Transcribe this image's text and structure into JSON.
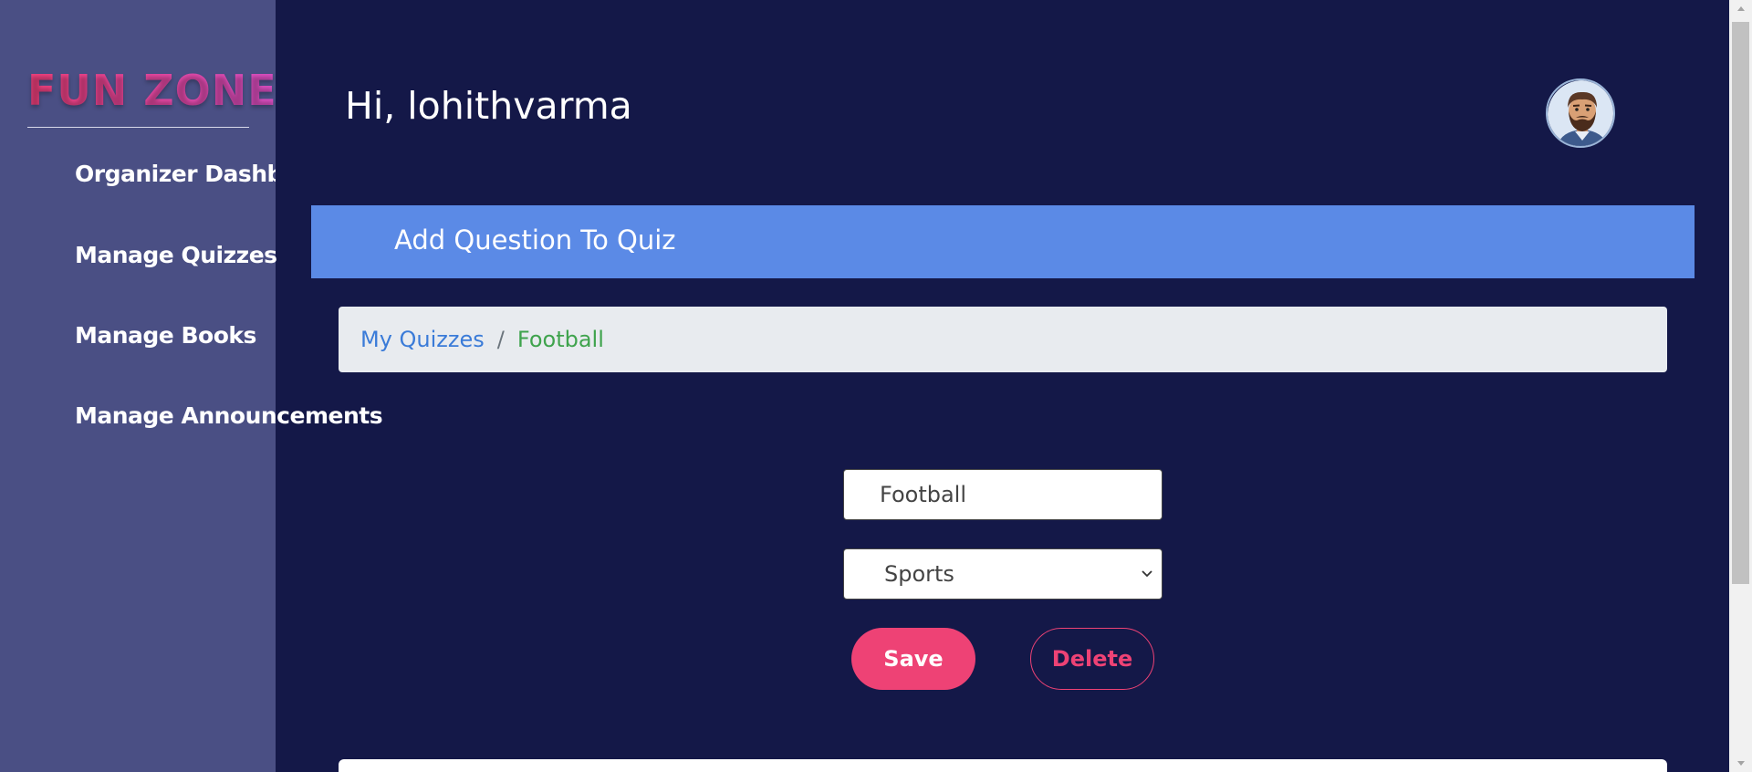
{
  "sidebar": {
    "logo": "FUN ZONE",
    "items": [
      {
        "label": "Organizer Dashboard"
      },
      {
        "label": "Manage Quizzes"
      },
      {
        "label": "Manage Books"
      },
      {
        "label": "Manage Announcements"
      }
    ]
  },
  "header": {
    "greeting": "Hi, lohithvarma",
    "title": "Add Question To Quiz"
  },
  "breadcrumb": {
    "link": "My Quizzes",
    "separator": "/",
    "active": "Football"
  },
  "form": {
    "quiz_name_value": "Football",
    "category_selected": "Sports",
    "save_label": "Save",
    "delete_label": "Delete"
  },
  "colors": {
    "background": "#141848",
    "sidebar": "#4a4f84",
    "header_bar": "#5b8ae6",
    "accent": "#ee4275"
  },
  "icons": {
    "avatar": "bearded-man-avatar",
    "select": "chevron-down-icon"
  }
}
